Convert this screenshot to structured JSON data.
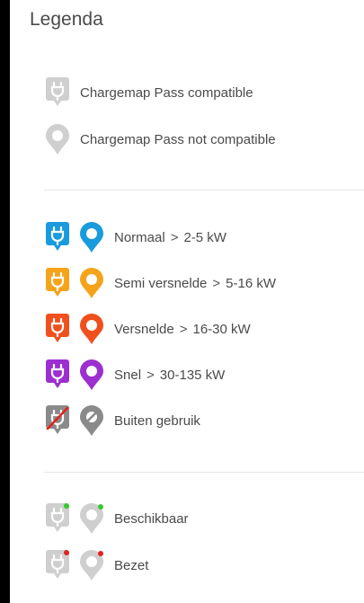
{
  "panel": {
    "title": "Legenda"
  },
  "compat": [
    {
      "label": "Chargemap Pass compatible",
      "icon": "plug-pin-icon"
    },
    {
      "label": "Chargemap Pass not compatible",
      "icon": "circle-pin-icon"
    }
  ],
  "power": [
    {
      "name": "Normaal",
      "range": "2-5 kW",
      "color": "#1a9bde"
    },
    {
      "name": "Semi versnelde",
      "range": "5-16 kW",
      "color": "#f5a31a"
    },
    {
      "name": "Versnelde",
      "range": "16-30 kW",
      "color": "#f0501e"
    },
    {
      "name": "Snel",
      "range": "30-135 kW",
      "color": "#9b2fd0"
    },
    {
      "name": "Buiten gebruik",
      "range": "",
      "color": "#8a8a8a"
    }
  ],
  "status": [
    {
      "label": "Beschikbaar",
      "dot": "#36c933"
    },
    {
      "label": "Bezet",
      "dot": "#e3221b"
    }
  ],
  "colors": {
    "inactive_gray": "#cfcfcf",
    "separator": ">"
  }
}
